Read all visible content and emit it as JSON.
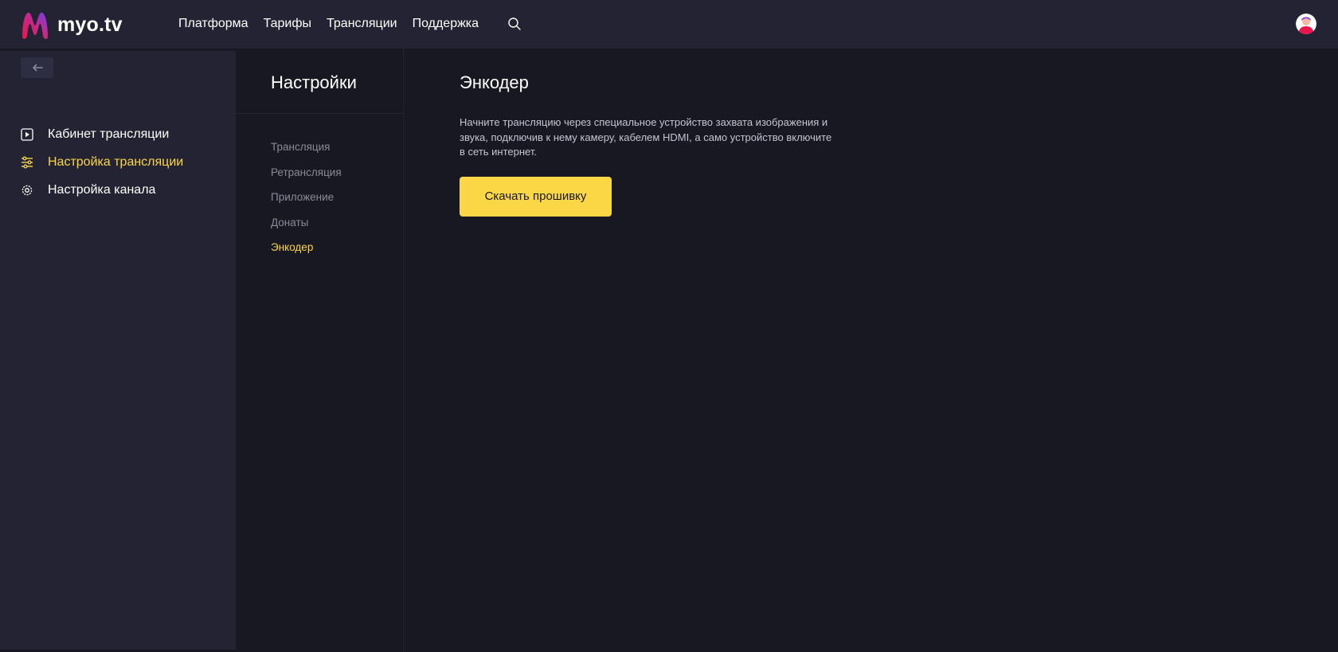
{
  "header": {
    "logo_text": "myo.tv",
    "nav": [
      {
        "label": "Платформа"
      },
      {
        "label": "Тарифы"
      },
      {
        "label": "Трансляции"
      },
      {
        "label": "Поддержка"
      }
    ],
    "search_icon": "search-icon",
    "avatar_icon": "user-avatar"
  },
  "sidebar": {
    "back_icon": "arrow-left-icon",
    "items": [
      {
        "label": "Кабинет трансляции",
        "icon": "play-square-icon",
        "active": false
      },
      {
        "label": "Настройка трансляции",
        "icon": "sliders-icon",
        "active": true
      },
      {
        "label": "Настройка канала",
        "icon": "gear-icon",
        "active": false
      }
    ]
  },
  "settings": {
    "title": "Настройки",
    "items": [
      {
        "label": "Трансляция",
        "active": false
      },
      {
        "label": "Ретрансляция",
        "active": false
      },
      {
        "label": "Приложение",
        "active": false
      },
      {
        "label": "Донаты",
        "active": false
      },
      {
        "label": "Энкодер",
        "active": true
      }
    ]
  },
  "content": {
    "title": "Энкодер",
    "description": "Начните трансляцию через специальное устройство захвата изображения и звука, подключив к нему камеру, кабелем HDMI, а само устройство включите в сеть интернет.",
    "download_label": "Скачать прошивку"
  },
  "colors": {
    "accent": "#fbd645",
    "background": "#181823",
    "panel": "#232333",
    "muted_text": "#8a8a99"
  }
}
